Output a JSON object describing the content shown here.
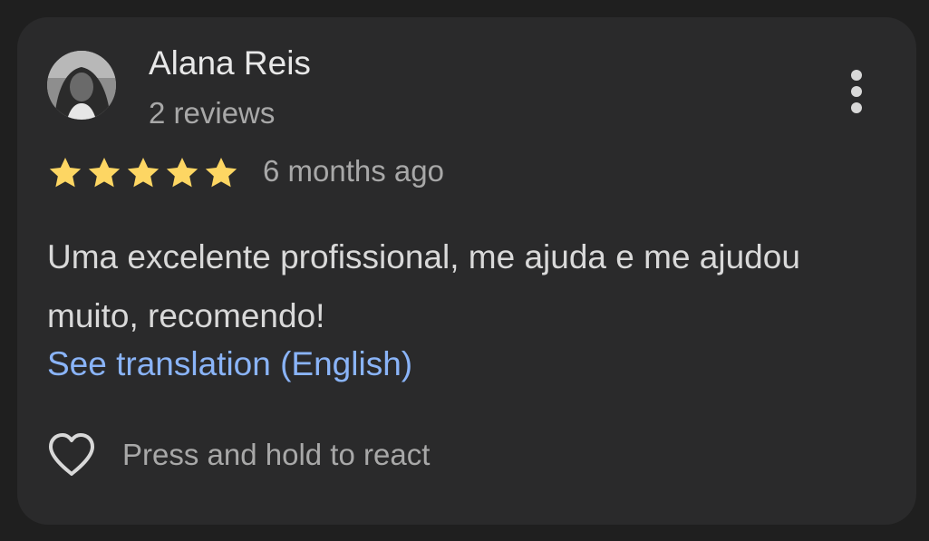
{
  "review": {
    "author_name": "Alana Reis",
    "author_review_count": "2 reviews",
    "rating": 5,
    "rating_max": 5,
    "star_color": "#fdd663",
    "time_ago": "6 months ago",
    "text": "Uma excelente profissional, me ajuda e me ajudou muito, recomendo!",
    "translate_link": "See translation (English)",
    "react_hint": "Press and hold to react"
  },
  "icons": {
    "menu": "more-vert-icon",
    "react": "heart-outline-icon",
    "star": "star-icon"
  },
  "colors": {
    "background": "#1f1f1f",
    "card": "#2a2a2b",
    "link": "#8ab4f8",
    "text_primary": "#e8e8e8",
    "text_secondary": "#a8a8a8"
  }
}
